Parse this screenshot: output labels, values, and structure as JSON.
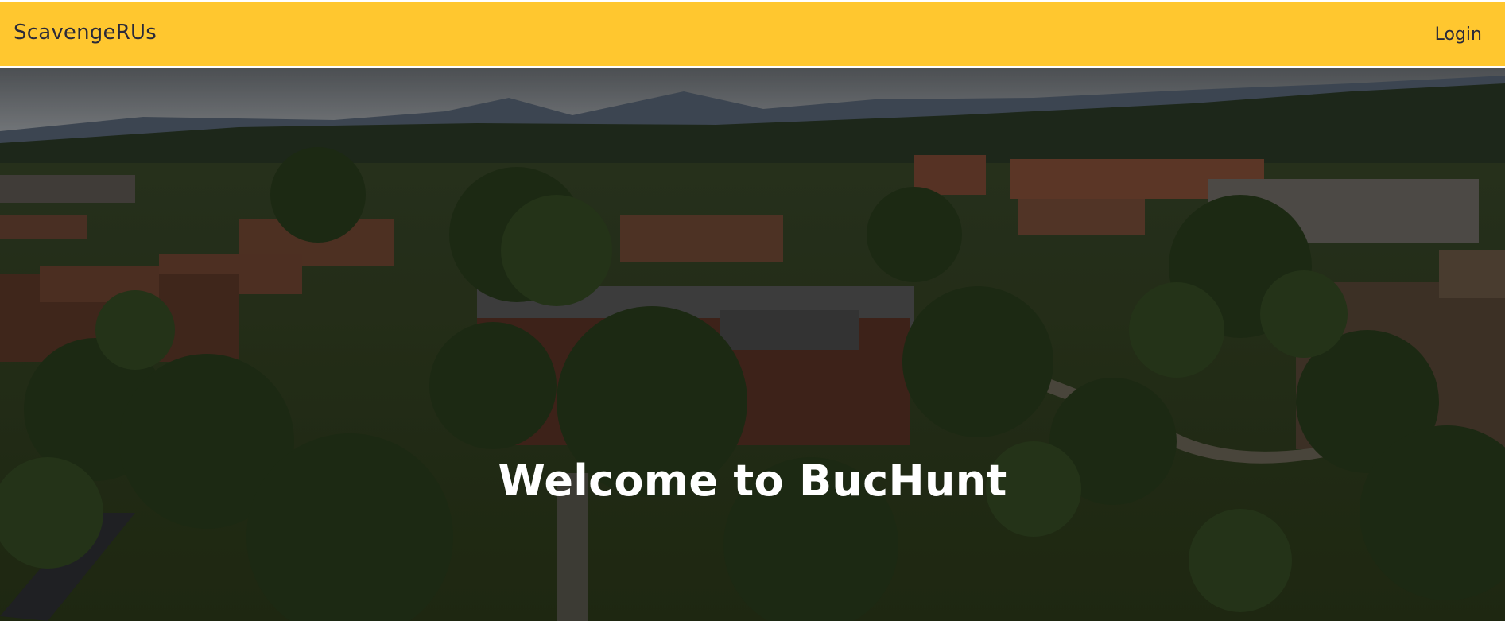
{
  "navbar": {
    "brand": "ScavengeRUs",
    "login_label": "Login",
    "background_color": "#ffc72f"
  },
  "hero": {
    "title": "Welcome to BucHunt",
    "image_description_icon": "campus-aerial-photo"
  }
}
